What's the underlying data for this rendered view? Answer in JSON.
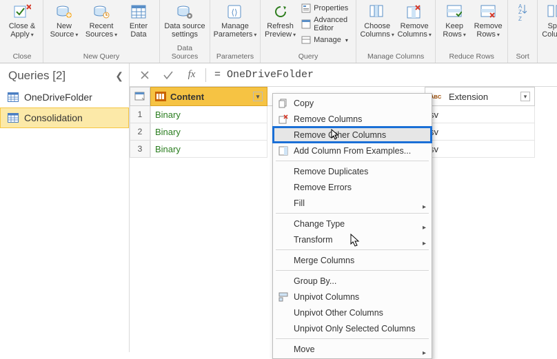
{
  "ribbon": {
    "groups": [
      {
        "label": "Close",
        "buttons": [
          {
            "label": "Close &\nApply",
            "dd": true,
            "icon": "close-apply"
          }
        ]
      },
      {
        "label": "New Query",
        "buttons": [
          {
            "label": "New\nSource",
            "dd": true,
            "icon": "new-source"
          },
          {
            "label": "Recent\nSources",
            "dd": true,
            "icon": "recent-sources"
          },
          {
            "label": "Enter\nData",
            "dd": false,
            "icon": "enter-data"
          }
        ]
      },
      {
        "label": "Data Sources",
        "buttons": [
          {
            "label": "Data source\nsettings",
            "dd": false,
            "icon": "data-source"
          }
        ]
      },
      {
        "label": "Parameters",
        "buttons": [
          {
            "label": "Manage\nParameters",
            "dd": true,
            "icon": "parameters"
          }
        ]
      },
      {
        "label": "Query",
        "buttons": [
          {
            "label": "Refresh\nPreview",
            "dd": true,
            "icon": "refresh"
          }
        ],
        "stack": [
          {
            "label": "Properties",
            "icon": "properties"
          },
          {
            "label": "Advanced Editor",
            "icon": "adv-editor"
          },
          {
            "label": "Manage",
            "dd": true,
            "icon": "manage"
          }
        ]
      },
      {
        "label": "Manage Columns",
        "buttons": [
          {
            "label": "Choose\nColumns",
            "dd": true,
            "icon": "choose-cols"
          },
          {
            "label": "Remove\nColumns",
            "dd": true,
            "icon": "remove-cols"
          }
        ]
      },
      {
        "label": "Reduce Rows",
        "buttons": [
          {
            "label": "Keep\nRows",
            "dd": true,
            "icon": "keep-rows"
          },
          {
            "label": "Remove\nRows",
            "dd": true,
            "icon": "remove-rows"
          }
        ]
      },
      {
        "label": "Sort",
        "buttons": [
          {
            "label": "",
            "icon": "sort"
          }
        ]
      },
      {
        "label": "",
        "buttons": [
          {
            "label": "Split\nColumn",
            "dd": true,
            "icon": "split"
          }
        ]
      }
    ]
  },
  "queries": {
    "title": "Queries [2]",
    "items": [
      {
        "name": "OneDriveFolder",
        "selected": false
      },
      {
        "name": "Consolidation",
        "selected": true
      }
    ]
  },
  "formula": "= OneDriveFolder",
  "grid": {
    "columns": [
      {
        "name": "Content",
        "type": "binary"
      },
      {
        "name": "Extension",
        "type": "text"
      }
    ],
    "rows": [
      {
        "n": 1,
        "content": "Binary",
        "ext": "sv"
      },
      {
        "n": 2,
        "content": "Binary",
        "ext": "sv"
      },
      {
        "n": 3,
        "content": "Binary",
        "ext": "sv"
      }
    ]
  },
  "ctx": {
    "items": [
      {
        "label": "Copy",
        "icon": "copy"
      },
      {
        "label": "Remove Columns",
        "icon": "remove-x",
        "hidden_behind": true
      },
      {
        "label": "Remove Other Columns",
        "highlight": true
      },
      {
        "label": "Add Column From Examples...",
        "icon": "add-col",
        "hidden_behind": true
      },
      {
        "sep": true
      },
      {
        "label": "Remove Duplicates"
      },
      {
        "label": "Remove Errors"
      },
      {
        "label": "Fill",
        "submenu": true
      },
      {
        "sep": true
      },
      {
        "label": "Change Type",
        "submenu": true
      },
      {
        "label": "Transform",
        "submenu": true
      },
      {
        "sep": true
      },
      {
        "label": "Merge Columns"
      },
      {
        "sep": true
      },
      {
        "label": "Group By..."
      },
      {
        "label": "Unpivot Columns",
        "icon": "unpivot"
      },
      {
        "label": "Unpivot Other Columns"
      },
      {
        "label": "Unpivot Only Selected Columns"
      },
      {
        "sep": true
      },
      {
        "label": "Move",
        "submenu": true
      }
    ]
  }
}
